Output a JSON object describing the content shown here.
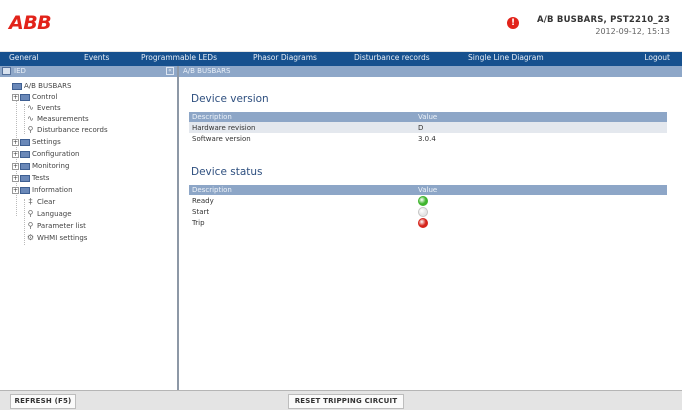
{
  "header": {
    "logo": "ABB",
    "alarm_icon": "!",
    "device_title": "A/B BUSBARS, PST2210_23",
    "datetime": "2012-09-12, 15:13"
  },
  "nav": {
    "items": [
      "General",
      "Events",
      "Programmable LEDs",
      "Phasor Diagrams",
      "Disturbance records",
      "Single Line Diagram"
    ],
    "logout": "Logout"
  },
  "tree": {
    "header": "IED",
    "collapse": "«",
    "items": [
      {
        "label": "A/B BUSBARS",
        "expander": "",
        "icon": "folder"
      },
      {
        "label": "Control",
        "expander": "+",
        "icon": "folder"
      },
      {
        "label": "Events",
        "expander": "",
        "icon": "doc"
      },
      {
        "label": "Measurements",
        "expander": "",
        "icon": "doc"
      },
      {
        "label": "Disturbance records",
        "expander": "",
        "icon": "doc"
      },
      {
        "label": "Settings",
        "expander": "+",
        "icon": "folder"
      },
      {
        "label": "Configuration",
        "expander": "+",
        "icon": "folder"
      },
      {
        "label": "Monitoring",
        "expander": "+",
        "icon": "folder"
      },
      {
        "label": "Tests",
        "expander": "+",
        "icon": "folder"
      },
      {
        "label": "Information",
        "expander": "+",
        "icon": "folder"
      },
      {
        "label": "Clear",
        "expander": "",
        "icon": "doc"
      },
      {
        "label": "Language",
        "expander": "",
        "icon": "doc"
      },
      {
        "label": "Parameter list",
        "expander": "",
        "icon": "doc"
      },
      {
        "label": "WHMI settings",
        "expander": "",
        "icon": "doc"
      }
    ]
  },
  "breadcrumb": "A/B BUSBARS",
  "version": {
    "title": "Device version",
    "columns": [
      "Description",
      "Value"
    ],
    "rows": [
      [
        "Hardware revision",
        "D"
      ],
      [
        "Software version",
        "3.0.4"
      ]
    ]
  },
  "status": {
    "title": "Device status",
    "columns": [
      "Description",
      "Value"
    ],
    "rows": [
      {
        "label": "Ready",
        "led_color": "#3fb52d"
      },
      {
        "label": "Start",
        "led_color": "#e6e6e6"
      },
      {
        "label": "Trip",
        "led_color": "#d5241b"
      }
    ]
  },
  "buttons": {
    "refresh": "REFRESH (F5)",
    "reset": "RESET TRIPPING CIRCUIT"
  },
  "colors": {
    "brand": "#e2231a",
    "nav": "#16508e",
    "header_bar": "#8ea7c8"
  }
}
